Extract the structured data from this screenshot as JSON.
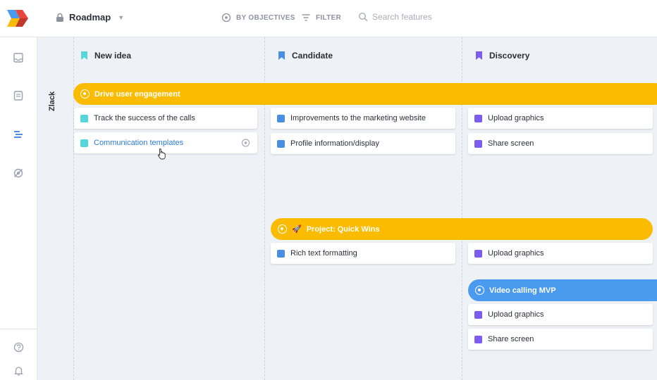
{
  "colors": {
    "cyan": "#55d6db",
    "blue": "#4a90e2",
    "purple": "#7d5cf0",
    "banner_yellow": "#fbbb00",
    "banner_blue": "#4a9af0"
  },
  "topbar": {
    "board_title": "Roadmap",
    "by_objectives": "BY OBJECTIVES",
    "filter": "FILTER",
    "search_placeholder": "Search features"
  },
  "sidebar": {
    "icons": [
      "inbox-icon",
      "notes-icon",
      "roadmap-icon",
      "hidden-eye-icon",
      "help-icon",
      "bell-icon"
    ]
  },
  "columns": [
    {
      "title": "New idea",
      "color": "#55d6db"
    },
    {
      "title": "Candidate",
      "color": "#4a90e2"
    },
    {
      "title": "Discovery",
      "color": "#7d5cf0"
    }
  ],
  "swimlane": {
    "label": "Zlack"
  },
  "objectives": {
    "drive": "Drive user engagement",
    "quickwins": "Project: Quick Wins",
    "videocall": "Video calling MVP"
  },
  "cards": {
    "new_idea": [
      "Track the success of the calls",
      "Communication templates"
    ],
    "candidate_drive": [
      "Improvements to the marketing website",
      "Profile information/display"
    ],
    "discovery_drive": [
      "Upload graphics",
      "Share screen"
    ],
    "candidate_quick": [
      "Rich text formatting"
    ],
    "discovery_quick": [
      "Upload graphics"
    ],
    "discovery_video": [
      "Upload graphics",
      "Share screen"
    ]
  }
}
